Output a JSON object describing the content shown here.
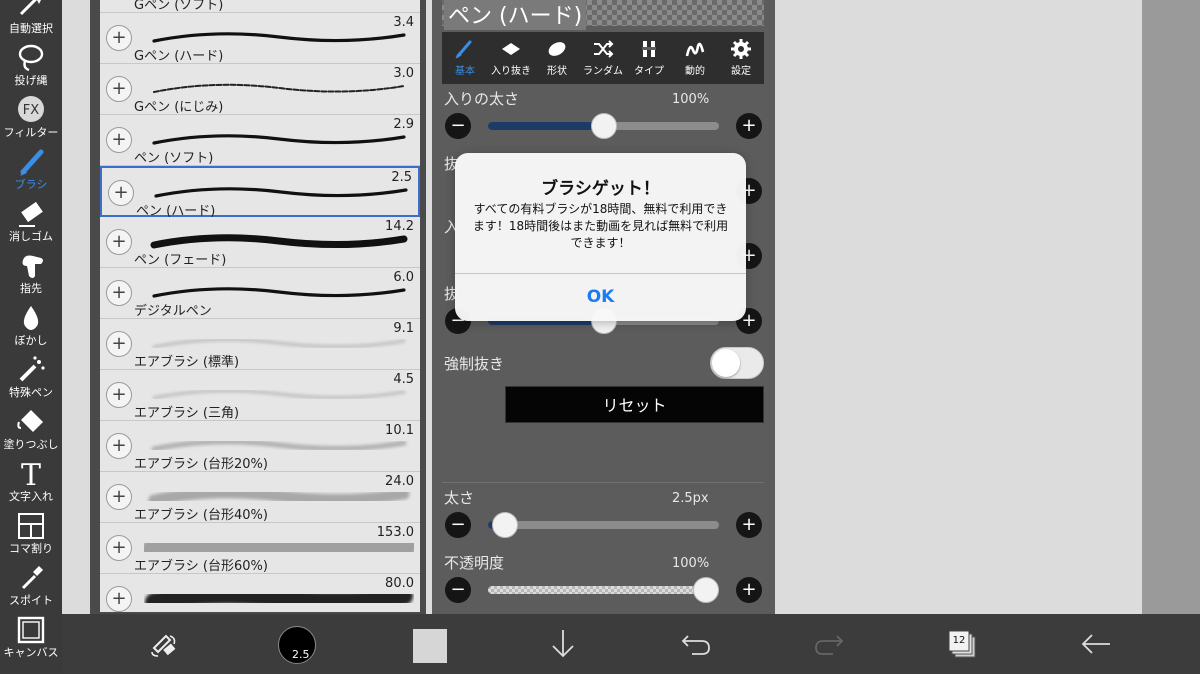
{
  "app": {
    "accent": "#3a8ee6",
    "panel_bg": "#5c5c5c",
    "toolbar_bg": "#3a3a3a"
  },
  "toolbar": {
    "items": [
      {
        "label": "自動選択",
        "icon": "magic-wand-icon",
        "active": false
      },
      {
        "label": "投げ縄",
        "icon": "lasso-icon",
        "active": false
      },
      {
        "label": "フィルター",
        "icon": "fx-icon",
        "active": false
      },
      {
        "label": "ブラシ",
        "icon": "brush-icon",
        "active": true
      },
      {
        "label": "消しゴム",
        "icon": "eraser-icon",
        "active": false
      },
      {
        "label": "指先",
        "icon": "finger-icon",
        "active": false
      },
      {
        "label": "ぼかし",
        "icon": "drop-icon",
        "active": false
      },
      {
        "label": "特殊ペン",
        "icon": "special-pen-icon",
        "active": false
      },
      {
        "label": "塗りつぶし",
        "icon": "bucket-icon",
        "active": false
      },
      {
        "label": "文字入れ",
        "icon": "text-icon",
        "active": false
      },
      {
        "label": "コマ割り",
        "icon": "panel-icon",
        "active": false
      },
      {
        "label": "スポイト",
        "icon": "eyedropper-icon",
        "active": false
      },
      {
        "label": "キャンバス",
        "icon": "canvas-icon",
        "active": false
      }
    ]
  },
  "brushes": [
    {
      "name": "Gペン (ソフト)",
      "size": "",
      "stroke": "thick"
    },
    {
      "name": "Gペン (ハード)",
      "size": "3.4",
      "stroke": "medium"
    },
    {
      "name": "Gペン (にじみ)",
      "size": "3.0",
      "stroke": "rough"
    },
    {
      "name": "ペン (ソフト)",
      "size": "2.9",
      "stroke": "medium"
    },
    {
      "name": "ペン (ハード)",
      "size": "2.5",
      "stroke": "medium",
      "selected": true
    },
    {
      "name": "ペン (フェード)",
      "size": "14.2",
      "stroke": "fade"
    },
    {
      "name": "デジタルペン",
      "size": "6.0",
      "stroke": "medium"
    },
    {
      "name": "エアブラシ (標準)",
      "size": "9.1",
      "stroke": "air-light"
    },
    {
      "name": "エアブラシ (三角)",
      "size": "4.5",
      "stroke": "air-light"
    },
    {
      "name": "エアブラシ (台形20%)",
      "size": "10.1",
      "stroke": "air-mid"
    },
    {
      "name": "エアブラシ (台形40%)",
      "size": "24.0",
      "stroke": "air-wide"
    },
    {
      "name": "エアブラシ (台形60%)",
      "size": "153.0",
      "stroke": "air-huge"
    },
    {
      "name": "",
      "size": "80.0",
      "stroke": "air-dark"
    }
  ],
  "settings": {
    "brush_title": "ペン (ハード)",
    "tabs": [
      {
        "label": "基本",
        "icon": "pen-icon",
        "active": true
      },
      {
        "label": "入り抜き",
        "icon": "taper-icon",
        "active": false
      },
      {
        "label": "形状",
        "icon": "shape-icon",
        "active": false
      },
      {
        "label": "ランダム",
        "icon": "shuffle-icon",
        "active": false
      },
      {
        "label": "タイプ",
        "icon": "type-icon",
        "active": false
      },
      {
        "label": "動的",
        "icon": "dynamic-icon",
        "active": false
      },
      {
        "label": "設定",
        "icon": "gear-icon",
        "active": false
      }
    ],
    "entry_width": {
      "label": "入りの太さ",
      "value": "100%",
      "level": 0.5
    },
    "hidden_row_1": {
      "label": "抜",
      "level": 0.5
    },
    "hidden_row_2": {
      "label": "入",
      "level": 0.5
    },
    "hidden_row_3": {
      "label": "抜",
      "level": 0.5
    },
    "force_taper": {
      "label": "強制抜き",
      "on": false
    },
    "reset_label": "リセット",
    "thickness": {
      "label": "太さ",
      "value": "2.5px",
      "level": 0.02
    },
    "opacity": {
      "label": "不透明度",
      "value": "100%",
      "level": 1.0
    }
  },
  "dialog": {
    "title": "ブラシゲット！",
    "message": "すべての有料ブラシが18時間、無料で利用できます！18時間後はまた動画を見れば無料で利用できます！",
    "ok_label": "OK"
  },
  "bottom_bar": {
    "brush_size_label": "2.5",
    "layer_count": "12"
  }
}
